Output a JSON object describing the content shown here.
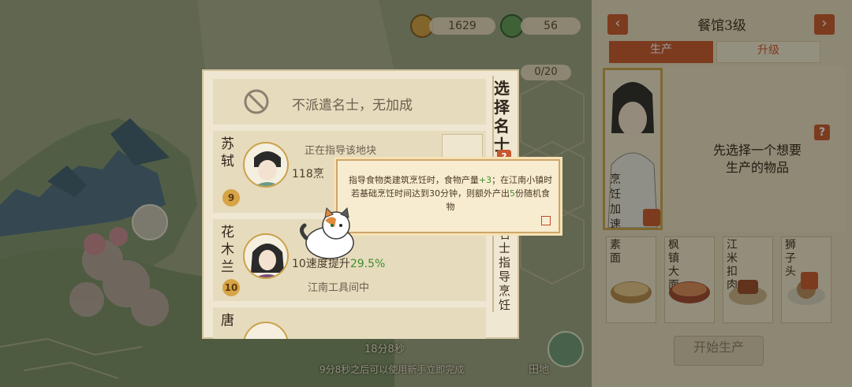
{
  "resources": {
    "coins": "1629",
    "leaves": "56"
  },
  "map": {
    "counter": "0/20",
    "timer": "18分8秒",
    "notice": "9分8秒之后可以使用新手立即完成",
    "field_label": "田地",
    "shop_label": "生产"
  },
  "right_panel": {
    "title": "餐馆3级",
    "prev_arrow": "‹",
    "next_arrow": "›",
    "tabs": [
      "生产",
      "升级"
    ],
    "hero_label": "烹饪加速",
    "prompt_line1": "先选择一个想要",
    "prompt_line2": "生产的物品",
    "help": "?",
    "foods": [
      {
        "name": "素面"
      },
      {
        "name": "枫镇大面"
      },
      {
        "name": "江米扣肉"
      },
      {
        "name": "狮子头"
      }
    ],
    "start_button": "开始生产"
  },
  "modal": {
    "no_assign": "不派遣名士，无加成",
    "side_title": "选择名士",
    "side_subtitle": "名士指导烹饪",
    "side_help": "?",
    "heroes": [
      {
        "name": "苏轼",
        "level": "9",
        "status": "正在指导该地块",
        "stat_value": "118",
        "stat_rest": "烹"
      },
      {
        "name": "花木兰",
        "level": "10",
        "status": "江南工具间中",
        "stat_value": "10",
        "stat_rest": "速度提升",
        "stat_green": "29.5%"
      },
      {
        "name": "唐",
        "level": "",
        "status": "",
        "stat_value": "",
        "stat_rest": ""
      }
    ]
  },
  "tooltip": {
    "text_a": "指导食物类建筑烹饪时，食物产量",
    "text_green_a": "+3",
    "text_b": "；在江南小镇时若基础烹饪时间达到30分钟，则额外产出",
    "text_green_b": "5",
    "text_c": "份随机食物"
  },
  "colors": {
    "accent": "#c8582f",
    "gold": "#d6a447",
    "green": "#3f8f2c"
  }
}
